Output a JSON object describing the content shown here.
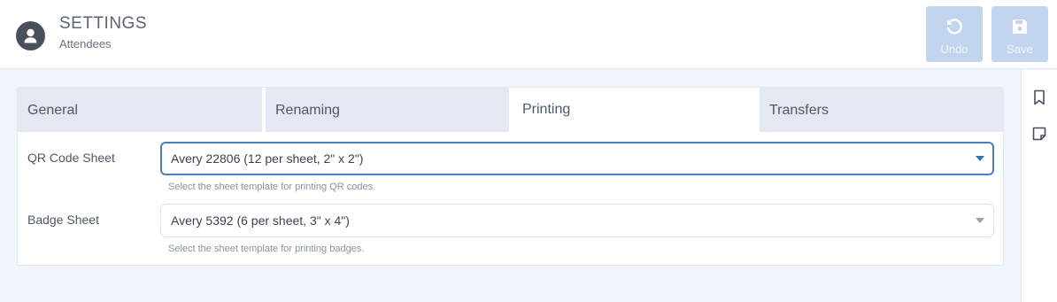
{
  "header": {
    "title": "SETTINGS",
    "subtitle": "Attendees",
    "undo_label": "Undo",
    "save_label": "Save"
  },
  "tabs": [
    {
      "label": "General"
    },
    {
      "label": "Renaming"
    },
    {
      "label": "Printing",
      "active": true
    },
    {
      "label": "Transfers"
    }
  ],
  "fields": {
    "qr": {
      "label": "QR Code Sheet",
      "value": "Avery 22806 (12 per sheet, 2\" x 2\")",
      "help": "Select the sheet template for printing QR codes."
    },
    "badge": {
      "label": "Badge Sheet",
      "value": "Avery 5392 (6 per sheet, 3\" x 4\")",
      "help": "Select the sheet template for printing badges."
    }
  },
  "icons": {
    "avatar": "user-avatar-icon",
    "undo": "undo-icon",
    "save": "floppy-disk-icon",
    "rail": [
      "bookmark-icon",
      "note-icon"
    ]
  },
  "colors": {
    "accent": "#4a7fc1",
    "button_disabled": "#c3d5ee",
    "tab_inactive": "#e4e9f1",
    "background": "#f0f4fb"
  }
}
